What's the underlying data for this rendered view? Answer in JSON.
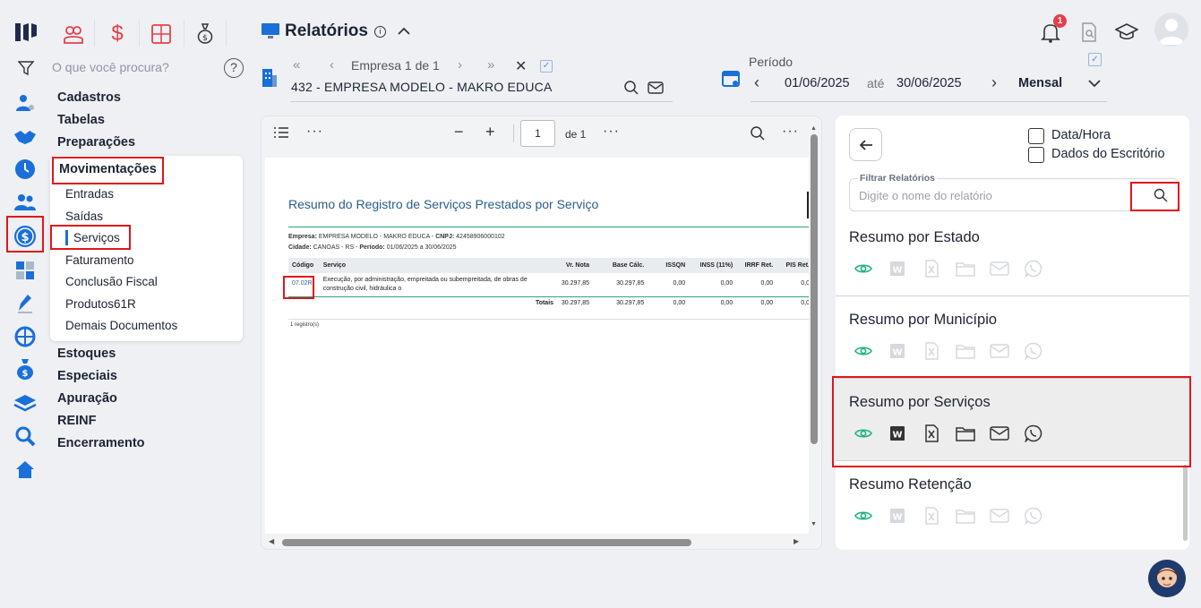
{
  "top": {
    "search_placeholder": "O que você procura?",
    "page_title": "Relatórios",
    "notification_count": "1"
  },
  "company": {
    "nav_label": "Empresa 1 de 1",
    "name": "432 - EMPRESA MODELO - MAKRO EDUCA"
  },
  "period": {
    "label": "Período",
    "start": "01/06/2025",
    "sep": "até",
    "end": "30/06/2025",
    "mode": "Mensal"
  },
  "menu": {
    "items": [
      "Cadastros",
      "Tabelas",
      "Preparações",
      "Movimentações"
    ],
    "sub": [
      "Entradas",
      "Saídas",
      "Serviços",
      "Faturamento",
      "Conclusão Fiscal",
      "Produtos61R",
      "Demais Documentos"
    ],
    "after": [
      "Estoques",
      "Especiais",
      "Apuração",
      "REINF",
      "Encerramento"
    ]
  },
  "viewer": {
    "page_value": "1",
    "page_total": "de 1",
    "report_title": "Resumo do Registro de Serviços Prestados por Serviço",
    "empresa_label": "Empresa:",
    "empresa_value": "EMPRESA MODELO - MAKRO EDUCA",
    "cnpj_label": "CNPJ:",
    "cnpj_value": "42458906000102",
    "cidade_label": "Cidade:",
    "cidade_value": "CANOAS - RS",
    "periodo_label": "Período:",
    "periodo_value": "01/06/2025 a 30/06/2025",
    "columns": [
      "Código",
      "Serviço",
      "Vr. Nota",
      "Base Cálc.",
      "ISSQN",
      "INSS (11%)",
      "IRRF Ret.",
      "PIS Ret."
    ],
    "row": {
      "codigo": "07.02R",
      "servico": "Execução, por administração, empreitada ou subempreitada, de obras de construção civil, hidráulica o",
      "vr_nota": "30.297,85",
      "base": "30.297,85",
      "issqn": "0,00",
      "inss": "0,00",
      "irrf": "0,00",
      "pis": "0,0"
    },
    "totals": {
      "label": "Totais",
      "vr_nota": "30.297,85",
      "base": "30.297,85",
      "issqn": "0,00",
      "inss": "0,00",
      "irrf": "0,00",
      "pis": "0,0"
    },
    "records": "1 registro(s)"
  },
  "right": {
    "opt_datahora": "Data/Hora",
    "opt_escritorio": "Dados do Escritório",
    "filter_label": "Filtrar Relatórios",
    "filter_placeholder": "Digite o nome do relatório",
    "reports": [
      "Resumo por Estado",
      "Resumo por Município",
      "Resumo por Serviços",
      "Resumo Retenção"
    ]
  },
  "colors": {
    "accent_blue": "#1a6fd8",
    "red_highlight": "#e0161b",
    "eye_green": "#1db37a",
    "report_title_blue": "#2a5d8a"
  }
}
